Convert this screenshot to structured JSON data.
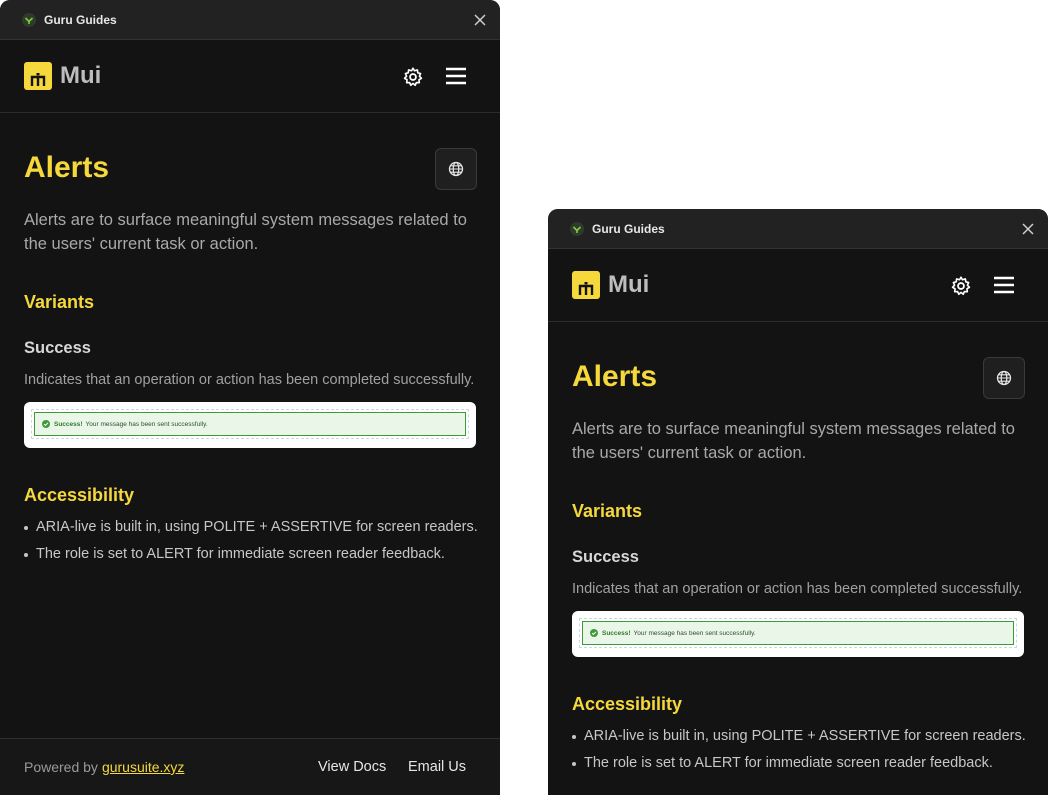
{
  "window": {
    "title": "Guru Guides"
  },
  "header": {
    "logo_text": "Mui"
  },
  "main": {
    "title": "Alerts",
    "intro": "Alerts are to surface meaningful system messages related to the users' current task or action.",
    "variants_heading": "Variants",
    "success": {
      "heading": "Success",
      "description": "Indicates that an operation or action has been completed successfully.",
      "demo": {
        "strong": "Success!",
        "message": "Your message has been sent successfully."
      }
    },
    "accessibility_heading": "Accessibility",
    "accessibility_items": [
      "ARIA-live is built in, using POLITE + ASSERTIVE for screen readers.",
      "The role is set to ALERT for immediate screen reader feedback."
    ]
  },
  "footer": {
    "powered_by": "Powered by",
    "powered_link": "gurusuite.xyz",
    "view_docs": "View Docs",
    "email_us": "Email Us"
  },
  "colors": {
    "accent": "#f5d83b",
    "background": "#131313",
    "success_border": "#3e9a38"
  }
}
